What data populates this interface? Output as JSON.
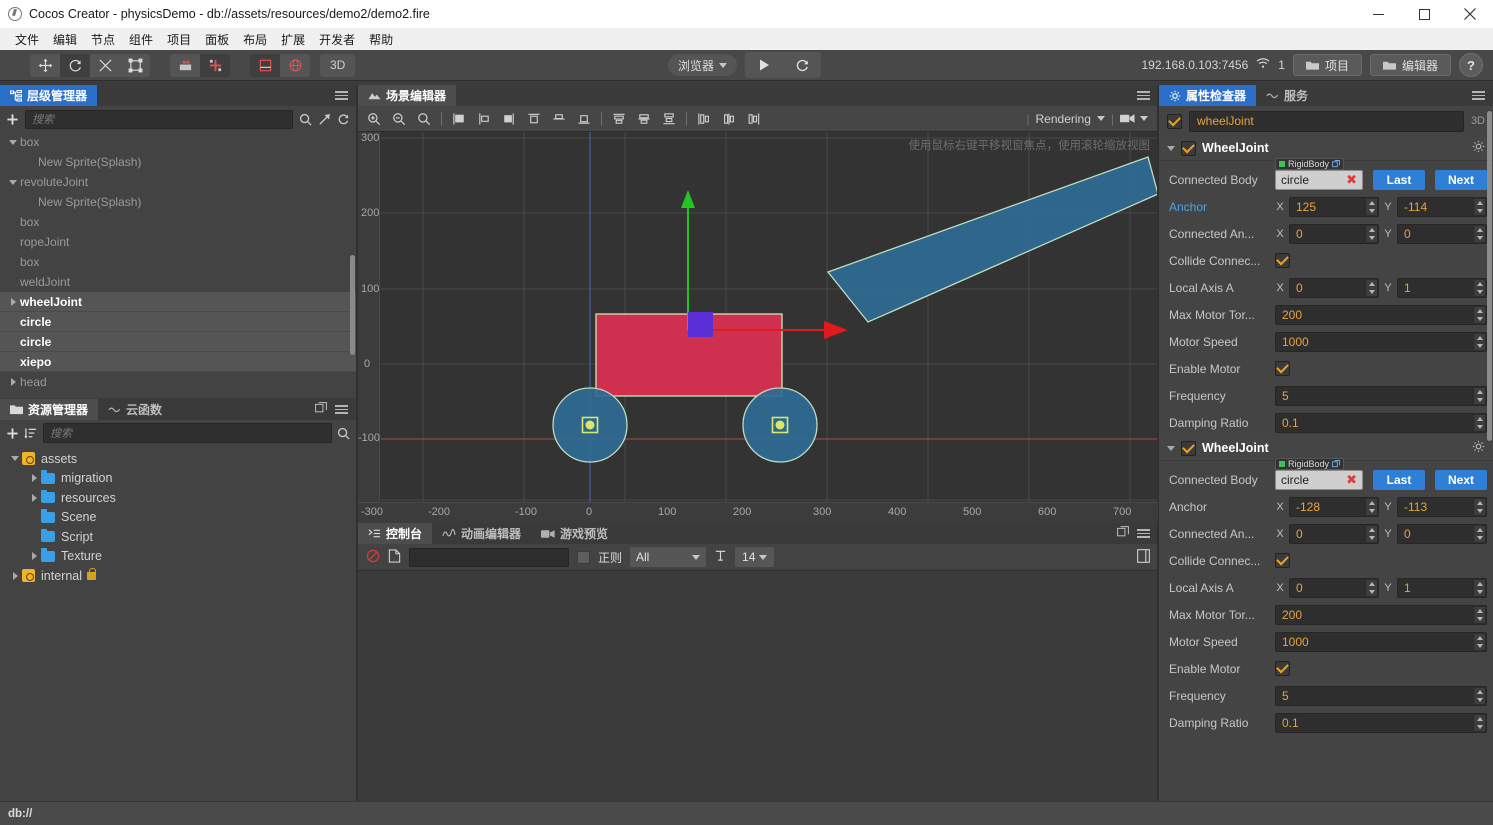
{
  "window": {
    "title": "Cocos Creator - physicsDemo - db://assets/resources/demo2/demo2.fire",
    "minimize": "─",
    "maximize": "□",
    "close": "✕"
  },
  "menu": {
    "items": [
      "文件",
      "编辑",
      "节点",
      "组件",
      "项目",
      "面板",
      "布局",
      "扩展",
      "开发者",
      "帮助"
    ]
  },
  "toolbar": {
    "transform_tools": [
      "move-tool",
      "rotate-tool",
      "scale-tool",
      "rect-tool"
    ],
    "pivot_tools": [
      "pivot-center-tool",
      "pivot-anchor-tool"
    ],
    "coord_tools": [
      "local-coord-tool",
      "global-coord-tool"
    ],
    "mode_3d": "3D",
    "browser_label": "浏览器",
    "play_label": "play-button",
    "refresh_label": "refresh-button",
    "ip_address": "192.168.0.103:7456",
    "device_count": "1",
    "project_button": "项目",
    "editor_button": "编辑器",
    "help_button": "?"
  },
  "hierarchy": {
    "tab_label": "层级管理器",
    "search_placeholder": "搜索",
    "nodes": [
      {
        "label": "box",
        "depth": 1,
        "expand": "down",
        "selected": false
      },
      {
        "label": "New Sprite(Splash)",
        "depth": 2,
        "expand": "none",
        "selected": false
      },
      {
        "label": "revoluteJoint",
        "depth": 1,
        "expand": "down",
        "selected": false
      },
      {
        "label": "New Sprite(Splash)",
        "depth": 2,
        "expand": "none",
        "selected": false
      },
      {
        "label": "box",
        "depth": 1,
        "expand": "none",
        "selected": false
      },
      {
        "label": "ropeJoint",
        "depth": 1,
        "expand": "none",
        "selected": false
      },
      {
        "label": "box",
        "depth": 1,
        "expand": "none",
        "selected": false
      },
      {
        "label": "weldJoint",
        "depth": 1,
        "expand": "none",
        "selected": false
      },
      {
        "label": "wheelJoint",
        "depth": 1,
        "expand": "right",
        "selected": true
      },
      {
        "label": "circle",
        "depth": 1,
        "expand": "none",
        "selected": true
      },
      {
        "label": "circle",
        "depth": 1,
        "expand": "none",
        "selected": true
      },
      {
        "label": "xiepo",
        "depth": 1,
        "expand": "none",
        "selected": true
      },
      {
        "label": "head",
        "depth": 1,
        "expand": "right",
        "selected": false
      }
    ]
  },
  "assets": {
    "tabs": [
      {
        "label": "资源管理器",
        "active": true
      },
      {
        "label": "云函数",
        "active": false
      }
    ],
    "search_placeholder": "搜索",
    "tree": [
      {
        "label": "assets",
        "depth": 0,
        "type": "db",
        "expand": "down"
      },
      {
        "label": "migration",
        "depth": 1,
        "type": "folder",
        "expand": "right"
      },
      {
        "label": "resources",
        "depth": 1,
        "type": "folder",
        "expand": "right"
      },
      {
        "label": "Scene",
        "depth": 1,
        "type": "folder",
        "expand": "none"
      },
      {
        "label": "Script",
        "depth": 1,
        "type": "folder",
        "expand": "none"
      },
      {
        "label": "Texture",
        "depth": 1,
        "type": "folder",
        "expand": "right"
      },
      {
        "label": "internal",
        "depth": 0,
        "type": "db",
        "expand": "right",
        "locked": true
      }
    ]
  },
  "scene": {
    "tab_label": "场景编辑器",
    "hint": "使用鼠标右键平移视窗焦点，使用滚轮缩放视图",
    "rendering_label": "Rendering",
    "ruler_y": [
      "300",
      "200",
      "100",
      "0",
      "-100"
    ],
    "ruler_x": [
      "-300",
      "-200",
      "-100",
      "0",
      "100",
      "200",
      "300",
      "400",
      "500",
      "600",
      "700"
    ],
    "objects": {
      "car_body_color": "#cf3050",
      "wheel_color": "#2f6a94",
      "ramp_color": "#2f6a94",
      "gizmo_color": "#5a2fd6",
      "axis_y_color": "#22c522",
      "axis_x_color": "#e01b1b",
      "outline_color": "#cfe8b0"
    }
  },
  "console": {
    "tabs": [
      {
        "label": "控制台",
        "active": true
      },
      {
        "label": "动画编辑器",
        "active": false
      },
      {
        "label": "游戏预览",
        "active": false
      }
    ],
    "filter_placeholder": "",
    "regex_label": "正则",
    "level_filter": "All",
    "font_size": "14"
  },
  "inspector": {
    "tabs": [
      {
        "label": "属性检查器",
        "active": true
      },
      {
        "label": "服务",
        "active": false
      }
    ],
    "node": {
      "enabled": true,
      "name": "wheelJoint",
      "mode_3d": "3D"
    },
    "components": [
      {
        "title": "WheelJoint",
        "enabled": true,
        "connected_body": {
          "label": "Connected Body",
          "tag": "RigidBody",
          "value": "circle",
          "remove": "✖",
          "last_button": "Last",
          "next_button": "Next"
        },
        "properties": [
          {
            "label": "Anchor",
            "accent": true,
            "type": "vec2",
            "x": "125",
            "y": "-114"
          },
          {
            "label": "Connected An...",
            "accent": false,
            "type": "vec2",
            "x": "0",
            "y": "0"
          },
          {
            "label": "Collide Connec...",
            "accent": false,
            "type": "bool",
            "value": true
          },
          {
            "label": "Local Axis A",
            "accent": false,
            "type": "vec2",
            "x": "0",
            "y": "1"
          },
          {
            "label": "Max Motor Tor...",
            "accent": false,
            "type": "num",
            "value": "200"
          },
          {
            "label": "Motor Speed",
            "accent": false,
            "type": "num",
            "value": "1000"
          },
          {
            "label": "Enable Motor",
            "accent": false,
            "type": "bool",
            "value": true
          },
          {
            "label": "Frequency",
            "accent": false,
            "type": "num",
            "value": "5"
          },
          {
            "label": "Damping Ratio",
            "accent": false,
            "type": "num",
            "value": "0.1"
          }
        ]
      },
      {
        "title": "WheelJoint",
        "enabled": true,
        "connected_body": {
          "label": "Connected Body",
          "tag": "RigidBody",
          "value": "circle",
          "remove": "✖",
          "last_button": "Last",
          "next_button": "Next"
        },
        "properties": [
          {
            "label": "Anchor",
            "accent": false,
            "type": "vec2",
            "x": "-128",
            "y": "-113"
          },
          {
            "label": "Connected An...",
            "accent": false,
            "type": "vec2",
            "x": "0",
            "y": "0"
          },
          {
            "label": "Collide Connec...",
            "accent": false,
            "type": "bool",
            "value": true
          },
          {
            "label": "Local Axis A",
            "accent": false,
            "type": "vec2",
            "x": "0",
            "y": "1"
          },
          {
            "label": "Max Motor Tor...",
            "accent": false,
            "type": "num",
            "value": "200"
          },
          {
            "label": "Motor Speed",
            "accent": false,
            "type": "num",
            "value": "1000"
          },
          {
            "label": "Enable Motor",
            "accent": false,
            "type": "bool",
            "value": true
          },
          {
            "label": "Frequency",
            "accent": false,
            "type": "num",
            "value": "5"
          },
          {
            "label": "Damping Ratio",
            "accent": false,
            "type": "num",
            "value": "0.1"
          }
        ]
      }
    ]
  },
  "statusbar": {
    "path": "db://"
  }
}
